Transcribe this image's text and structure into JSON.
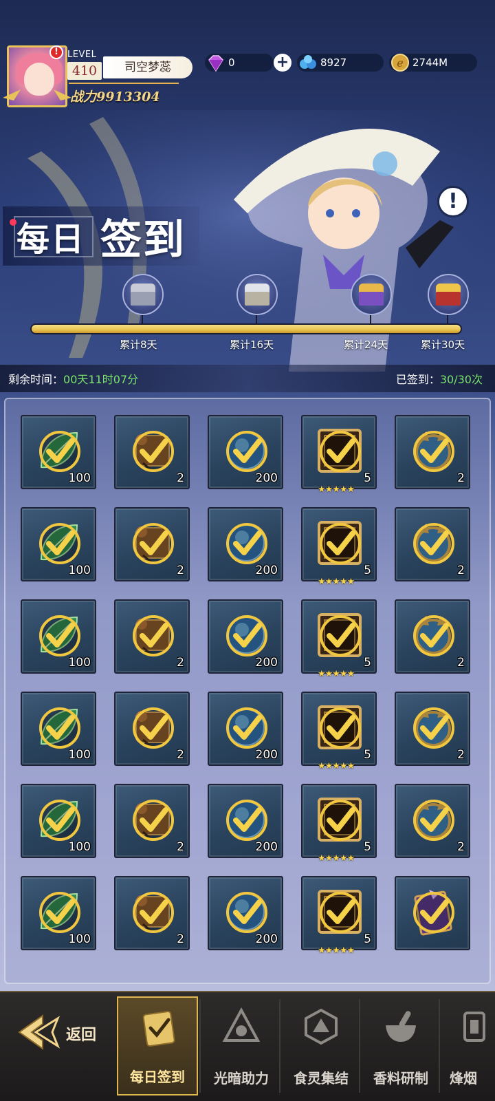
{
  "player": {
    "level_label": "LEVEL",
    "level": "410",
    "name": "司空梦蕊",
    "power": "战力9913304",
    "alert": "!"
  },
  "resources": {
    "gems": "0",
    "crystals": "8927",
    "coins": "2744M",
    "plus": "+"
  },
  "banner": {
    "title_a": "每日",
    "title_b": "签到",
    "info": "!"
  },
  "progress": {
    "fraction": 1.0,
    "milestones": [
      {
        "label": "累计8天"
      },
      {
        "label": "累计16天"
      },
      {
        "label": "累计24天"
      },
      {
        "label": "累计30天"
      }
    ]
  },
  "status": {
    "remaining_label": "剩余时间：",
    "remaining_value": "00天11时07分",
    "signed_label": "已签到：",
    "signed_value": "30/30次"
  },
  "rewards": [
    {
      "qty": "100",
      "kind": "leaf",
      "stars": ""
    },
    {
      "qty": "2",
      "kind": "scroll",
      "stars": ""
    },
    {
      "qty": "200",
      "kind": "orb",
      "stars": ""
    },
    {
      "qty": "5",
      "kind": "book",
      "stars": "★★★★★"
    },
    {
      "qty": "2",
      "kind": "medal",
      "stars": ""
    },
    {
      "qty": "100",
      "kind": "leaf",
      "stars": ""
    },
    {
      "qty": "2",
      "kind": "scroll",
      "stars": ""
    },
    {
      "qty": "200",
      "kind": "orb",
      "stars": ""
    },
    {
      "qty": "5",
      "kind": "book",
      "stars": "★★★★★"
    },
    {
      "qty": "2",
      "kind": "medal",
      "stars": ""
    },
    {
      "qty": "100",
      "kind": "leaf",
      "stars": ""
    },
    {
      "qty": "2",
      "kind": "scroll",
      "stars": ""
    },
    {
      "qty": "200",
      "kind": "orb",
      "stars": ""
    },
    {
      "qty": "5",
      "kind": "book",
      "stars": "★★★★★"
    },
    {
      "qty": "2",
      "kind": "medal",
      "stars": ""
    },
    {
      "qty": "100",
      "kind": "leaf",
      "stars": ""
    },
    {
      "qty": "2",
      "kind": "scroll",
      "stars": ""
    },
    {
      "qty": "200",
      "kind": "orb",
      "stars": ""
    },
    {
      "qty": "5",
      "kind": "book",
      "stars": "★★★★★"
    },
    {
      "qty": "2",
      "kind": "medal",
      "stars": ""
    },
    {
      "qty": "100",
      "kind": "leaf",
      "stars": ""
    },
    {
      "qty": "2",
      "kind": "scroll",
      "stars": ""
    },
    {
      "qty": "200",
      "kind": "orb",
      "stars": ""
    },
    {
      "qty": "5",
      "kind": "book",
      "stars": "★★★★★"
    },
    {
      "qty": "2",
      "kind": "medal",
      "stars": ""
    },
    {
      "qty": "100",
      "kind": "leaf",
      "stars": ""
    },
    {
      "qty": "2",
      "kind": "scroll",
      "stars": ""
    },
    {
      "qty": "200",
      "kind": "orb",
      "stars": ""
    },
    {
      "qty": "5",
      "kind": "book",
      "stars": "★★★★★"
    },
    {
      "qty": "",
      "kind": "card",
      "stars": ""
    }
  ],
  "nav": {
    "back": "返回",
    "items": [
      {
        "label": "每日签到",
        "icon": "checklist-icon"
      },
      {
        "label": "光暗助力",
        "icon": "triangle-emblem-icon"
      },
      {
        "label": "食灵集结",
        "icon": "hex-emblem-icon"
      },
      {
        "label": "香料研制",
        "icon": "mortar-icon"
      },
      {
        "label": "烽烟",
        "icon": "lantern-icon"
      }
    ]
  },
  "colors": {
    "accent_gold": "#e9c34f",
    "status_green": "#7be36b",
    "cell_bg": "#2a435d"
  }
}
